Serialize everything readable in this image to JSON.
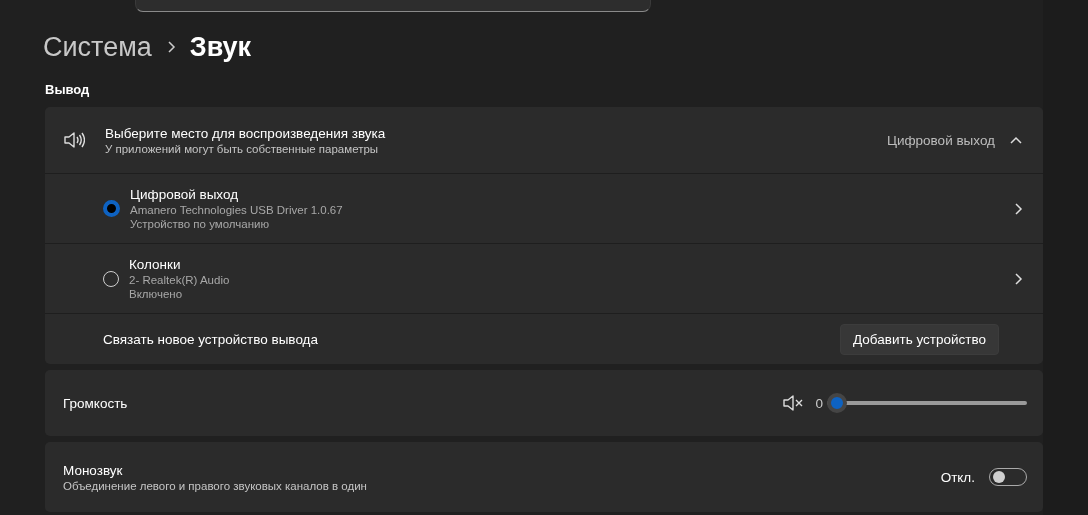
{
  "breadcrumb": [
    "Система",
    "Звук"
  ],
  "section_title": "Вывод",
  "output": {
    "title": "Выберите место для воспроизведения звука",
    "subtitle": "У приложений могут быть собственные параметры",
    "current": "Цифровой выход",
    "expanded": true,
    "devices": [
      {
        "name": "Цифровой выход",
        "driver": "Amanero Technologies USB Driver 1.0.67",
        "status": "Устройство по умолчанию",
        "selected": true
      },
      {
        "name": "Колонки",
        "driver": "2- Realtek(R) Audio",
        "status": "Включено",
        "selected": false
      }
    ],
    "pair_label": "Связать новое устройство вывода",
    "pair_button": "Добавить устройство"
  },
  "volume": {
    "label": "Громкость",
    "muted": true,
    "reading": "0",
    "level": 0
  },
  "mono": {
    "label": "Монозвук",
    "description": "Объединение левого и правого звуковых каналов в один",
    "state_label": "Откл.",
    "on": false
  }
}
